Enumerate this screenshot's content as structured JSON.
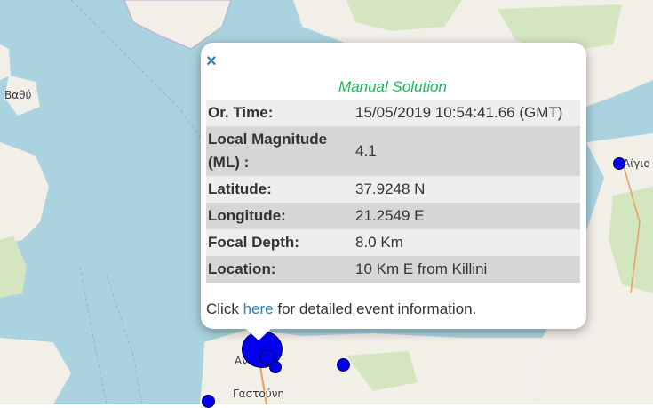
{
  "map": {
    "labels": [
      "Βαθύ",
      "Αίγιο",
      "Ανδρίδα",
      "Γαστούνη"
    ],
    "colors": {
      "sea": "#aad3df",
      "land": "#f2efe9",
      "forest": "#d3e6c0",
      "quake": "#0000ee"
    }
  },
  "popup": {
    "close_label": "×",
    "title": "Manual Solution",
    "rows": [
      {
        "key": "Or. Time:",
        "value": "15/05/2019 10:54:41.66 (GMT)"
      },
      {
        "key": "Local Magnitude (ML) :",
        "value": "4.1"
      },
      {
        "key": "Latitude:",
        "value": "37.9248 N"
      },
      {
        "key": "Longitude:",
        "value": "21.2549 E"
      },
      {
        "key": "Focal Depth:",
        "value": "8.0 Km"
      },
      {
        "key": "Location:",
        "value": "10 Km E from Killini"
      }
    ],
    "footer_prefix": "Click",
    "footer_link": "here",
    "footer_suffix": "for detailed event information."
  }
}
